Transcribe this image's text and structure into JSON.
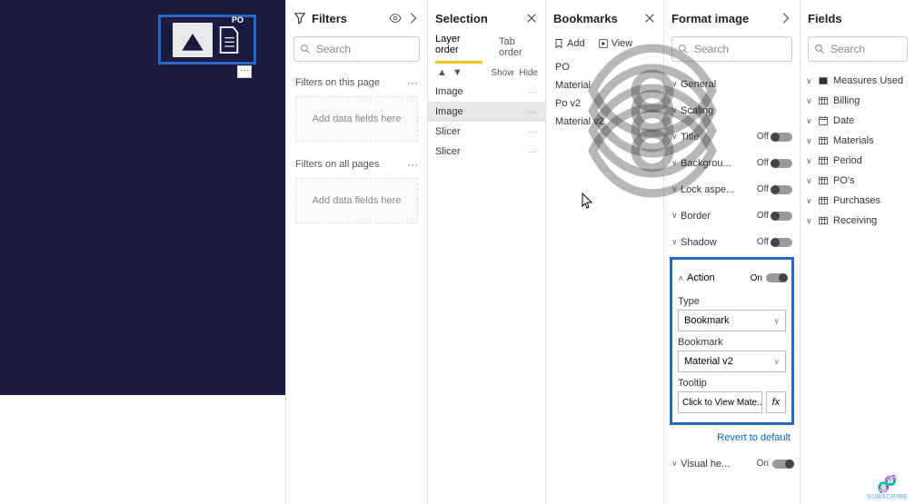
{
  "canvas": {
    "visual_label": "PO"
  },
  "filters": {
    "title": "Filters",
    "search_placeholder": "Search",
    "section_page": "Filters on this page",
    "section_all": "Filters on all pages",
    "drop_hint": "Add data fields here"
  },
  "selection": {
    "title": "Selection",
    "tab_layer": "Layer order",
    "tab_tab": "Tab order",
    "show": "Show",
    "hide": "Hide",
    "items": [
      "Image",
      "Image",
      "Slicer",
      "Slicer"
    ]
  },
  "bookmarks": {
    "title": "Bookmarks",
    "add": "Add",
    "view": "View",
    "items": [
      "PO",
      "Material",
      "Po v2",
      "Material v2"
    ]
  },
  "format": {
    "title": "Format image",
    "search_placeholder": "Search",
    "rows": [
      {
        "label": "General",
        "state": ""
      },
      {
        "label": "Scaling",
        "state": ""
      },
      {
        "label": "Title",
        "state": "Off"
      },
      {
        "label": "Backgrou...",
        "state": "Off"
      },
      {
        "label": "Lock aspe...",
        "state": "Off"
      },
      {
        "label": "Border",
        "state": "Off"
      },
      {
        "label": "Shadow",
        "state": "Off"
      }
    ],
    "action": {
      "label": "Action",
      "state": "On",
      "type_label": "Type",
      "type_value": "Bookmark",
      "bookmark_label": "Bookmark",
      "bookmark_value": "Material v2",
      "tooltip_label": "Tooltip",
      "tooltip_value": "Click to View Mate..."
    },
    "revert": "Revert to default",
    "visual_header": {
      "label": "Visual he...",
      "state": "On"
    }
  },
  "fields": {
    "title": "Fields",
    "search_placeholder": "Search",
    "items": [
      {
        "label": "Measures Used",
        "icon": "measures"
      },
      {
        "label": "Billing",
        "icon": "table"
      },
      {
        "label": "Date",
        "icon": "date"
      },
      {
        "label": "Materials",
        "icon": "table"
      },
      {
        "label": "Period",
        "icon": "table"
      },
      {
        "label": "PO's",
        "icon": "table"
      },
      {
        "label": "Purchases",
        "icon": "table"
      },
      {
        "label": "Receiving",
        "icon": "table"
      }
    ]
  },
  "subscribe": "SUBSCRIBE"
}
